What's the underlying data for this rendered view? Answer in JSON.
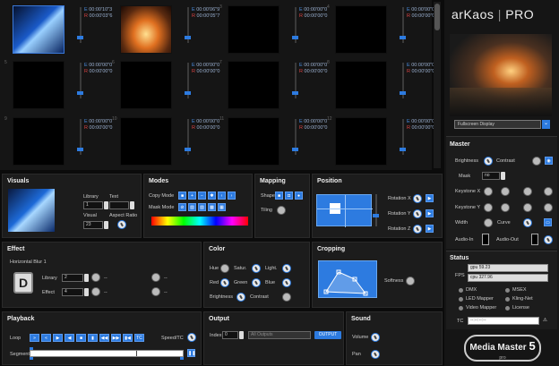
{
  "grid": {
    "cells": [
      {
        "num": "",
        "e": "00:00'10\"3",
        "r": "00:00'03\"6",
        "img": "blue"
      },
      {
        "num": "",
        "e": "00:00'06\"9",
        "r": "00:00'05\"7",
        "img": "fire"
      },
      {
        "num": "3",
        "e": "00:00'00\"0",
        "r": "00:00'00\"0",
        "img": ""
      },
      {
        "num": "4",
        "e": "00:00'00\"0",
        "r": "00:00'00\"0",
        "img": ""
      },
      {
        "num": "5",
        "e": "00:00'00\"0",
        "r": "00:00'00\"0",
        "img": ""
      },
      {
        "num": "6",
        "e": "00:00'00\"0",
        "r": "00:00'00\"0",
        "img": ""
      },
      {
        "num": "7",
        "e": "00:00'00\"0",
        "r": "00:00'00\"0",
        "img": ""
      },
      {
        "num": "8",
        "e": "00:00'00\"0",
        "r": "00:00'00\"0",
        "img": ""
      },
      {
        "num": "9",
        "e": "00:00'00\"0",
        "r": "00:00'00\"0",
        "img": ""
      },
      {
        "num": "10",
        "e": "00:00'00\"0",
        "r": "00:00'00\"0",
        "img": ""
      },
      {
        "num": "11",
        "e": "00:00'00\"0",
        "r": "00:00'00\"0",
        "img": ""
      },
      {
        "num": "12",
        "e": "00:00'00\"0",
        "r": "00:00'00\"0",
        "img": ""
      }
    ]
  },
  "visuals": {
    "title": "Visuals",
    "library": "Library",
    "text": "Text",
    "visual": "Visual",
    "aspect": "Aspect Ratio",
    "library_val": "1",
    "text_val": "",
    "visual_val": "23"
  },
  "modes": {
    "title": "Modes",
    "copy": "Copy Mode",
    "mask": "Mask Mode"
  },
  "mapping": {
    "title": "Mapping",
    "shape": "Shape",
    "tiling": "Tiling"
  },
  "position": {
    "title": "Position",
    "rx": "Rotation X",
    "ry": "Rotation Y",
    "rz": "Rotation Z"
  },
  "effect": {
    "title": "Effect",
    "name": "Horizontal Blur 1",
    "library": "Library",
    "effect": "Effect",
    "library_val": "2",
    "effect_val": "4",
    "dash": "--"
  },
  "color": {
    "title": "Color",
    "hue": "Hue",
    "satur": "Satur.",
    "light": "Light.",
    "red": "Red",
    "green": "Green",
    "blue": "Blue",
    "brightness": "Brightness",
    "contrast": "Contrast"
  },
  "cropping": {
    "title": "Cropping",
    "softness": "Softness"
  },
  "playback": {
    "title": "Playback",
    "loop": "Loop",
    "speed": "Speed/TC",
    "segment": "Segment"
  },
  "output": {
    "title": "Output",
    "index": "Index",
    "index_val": "0",
    "outputs": "All Outputs",
    "button": "OUTPUT"
  },
  "sound": {
    "title": "Sound",
    "volume": "Volume",
    "pan": "Pan"
  },
  "sidebar": {
    "logo_a": "arKaos",
    "logo_sep": "|",
    "logo_b": "PRO",
    "display": "Fullscreen Display",
    "master_title": "Master",
    "brightness": "Brightness",
    "contrast": "Contrast",
    "mask": "Mask",
    "mask_val": "no",
    "kx": "Keystone X",
    "ky": "Keystone Y",
    "width": "Width",
    "curve": "Curve",
    "audio_in": "Audio-In",
    "audio_out": "Audio-Out",
    "status_title": "Status",
    "fps": "FPS",
    "gpu": "gpu 59.23",
    "cpu": "cpu 327.96",
    "dmx": "DMX",
    "msex": "MSEX",
    "led": "LED Mapper",
    "kling": "Kling-Net",
    "video": "Video Mapper",
    "license": "License",
    "tc": "TC",
    "tc_val": "--:--:--:--",
    "brand": "Media Master",
    "brand_num": "5",
    "brand_sub": "pro"
  },
  "colors": {
    "accent": "#2d7be0",
    "panel": "#1c1c1c",
    "bg": "#0b0b0b"
  }
}
